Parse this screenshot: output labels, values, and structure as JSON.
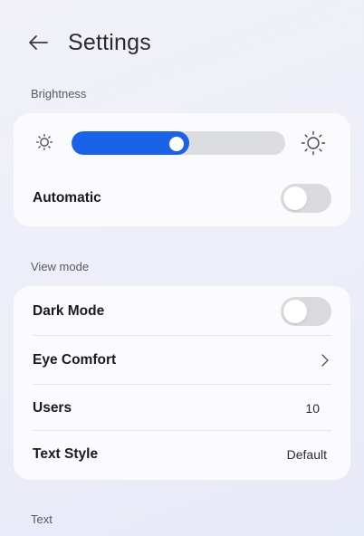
{
  "header": {
    "title": "Settings",
    "back_icon": "arrow-left-icon"
  },
  "sections": {
    "brightness": {
      "label": "Brightness",
      "level_percent": 55,
      "min_icon": "sun-small-icon",
      "max_icon": "sun-large-icon",
      "automatic_label": "Automatic",
      "automatic_on": false
    },
    "view_mode": {
      "label": "View mode",
      "dark_mode_label": "Dark Mode",
      "dark_mode_on": false,
      "eye_comfort_label": "Eye Comfort",
      "users_label": "Users",
      "users_value": "10",
      "text_style_label": "Text Style",
      "text_style_value": "Default"
    },
    "text": {
      "label": "Text"
    }
  },
  "colors": {
    "accent": "#1a63e8",
    "track": "#dcdde1",
    "toggle_off": "#d9dadd"
  }
}
